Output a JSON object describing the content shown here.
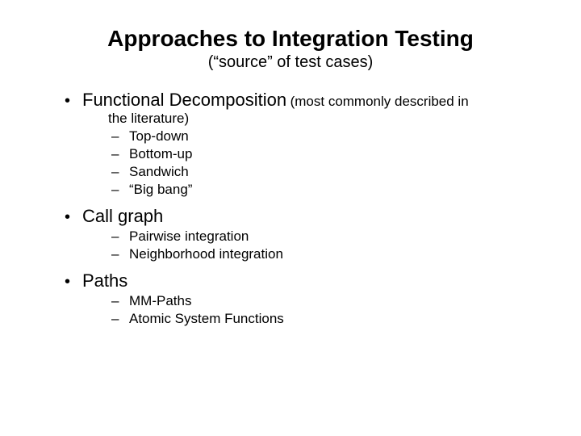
{
  "title": "Approaches to Integration Testing",
  "subtitle": "(“source” of test cases)",
  "items": [
    {
      "label": "Functional Decomposition",
      "note_inline": "(most commonly described in",
      "note_cont": "the literature)",
      "sub": [
        "Top-down",
        "Bottom-up",
        "Sandwich",
        "“Big bang”"
      ]
    },
    {
      "label": "Call graph",
      "sub": [
        "Pairwise integration",
        "Neighborhood integration"
      ]
    },
    {
      "label": "Paths",
      "sub": [
        "MM-Paths",
        "Atomic System Functions"
      ]
    }
  ]
}
